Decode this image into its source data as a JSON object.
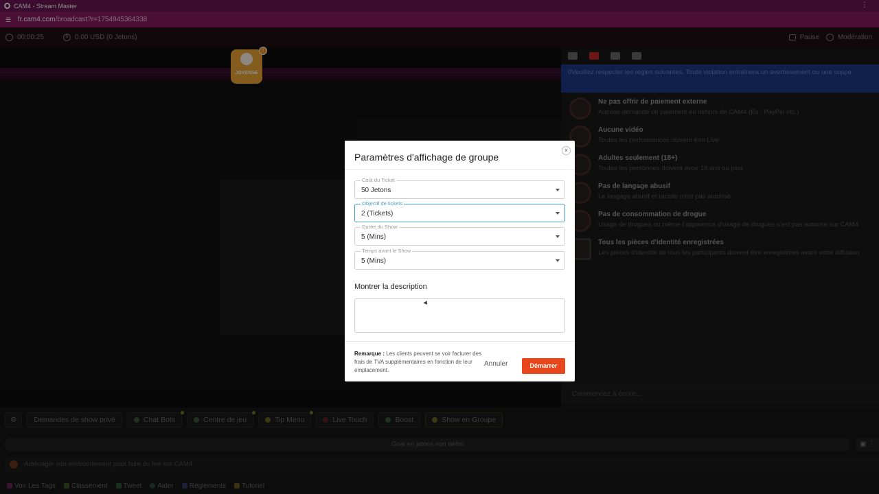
{
  "window": {
    "title": "CAM4 - Stream Master",
    "url_host": "fr.cam4.com",
    "url_path": "/broadcast?r=1754945364338"
  },
  "status": {
    "time": "00:00:25",
    "balance": "0.00 USD (0 Jetons)",
    "pause_label": "Pause",
    "moderation_label": "Modération"
  },
  "badge": {
    "label": "JOVENSE",
    "count": "!"
  },
  "rules": {
    "banner": "0Veuillez respecter les règles suivantes. Toute violation entraînera un avertissement ou une suspe",
    "items": [
      {
        "title": "Ne pas offrir de paiement externe",
        "desc": "Aucune demande de paiement en dehors de CAM4 (Ex : PayPal etc.)"
      },
      {
        "title": "Aucune vidéo",
        "desc": "Toutes les performances doivent être Live"
      },
      {
        "title": "Adultes seulement (18+)",
        "desc": "Toutes les personnes doivent avoir 18 ans ou plus"
      },
      {
        "title": "Pas de langage abusif",
        "desc": "Le langage abusif et raciste n'est pas autorisé"
      },
      {
        "title": "Pas de consommation de drogue",
        "desc": "Usage de drogues ou même l'apparence d'usage de drogues n'est pas autorisé sur CAM4"
      },
      {
        "title": "Tous les pièces d'identité enregistrées",
        "desc": "Les pièces d'identité de tous les participants doivent être enregistrées avant votre diffusion"
      }
    ]
  },
  "chat": {
    "placeholder": "Commencez à écrire..."
  },
  "toolbar": {
    "private_show": "Demandes de show privé",
    "chat_bots": "Chat Bots",
    "game_center": "Centre de jeu",
    "tip_menu": "Tip Menu",
    "live_touch": "Live Touch",
    "boost": "Boost",
    "group_show": "Show en Groupe"
  },
  "goal": {
    "text": "Goal en jetons non défini"
  },
  "environment": {
    "text": "Aménager son environnement pour faire du live sur CAM4"
  },
  "footer": {
    "links": [
      "Voir Les Tags",
      "Classement",
      "Tweet",
      "Aider",
      "Règlements",
      "Tutoriel"
    ]
  },
  "modal": {
    "title": "Paramètres d'affichage de groupe",
    "close": "×",
    "fields": [
      {
        "label": "Coût du Ticket",
        "value": "50 Jetons"
      },
      {
        "label": "Objectif de tickets",
        "value": "2 (Tickets)"
      },
      {
        "label": "Durée du Show",
        "value": "5 (Mins)"
      },
      {
        "label": "Temps avant le Show",
        "value": "5 (Mins)"
      }
    ],
    "description_title": "Montrer la description",
    "note_bold": "Remarque :",
    "note_text": "Les clients peuvent se voir facturer des frais de TVA supplémentaires en fonction de leur emplacement.",
    "cancel": "Annuler",
    "start": "Démarrer"
  }
}
